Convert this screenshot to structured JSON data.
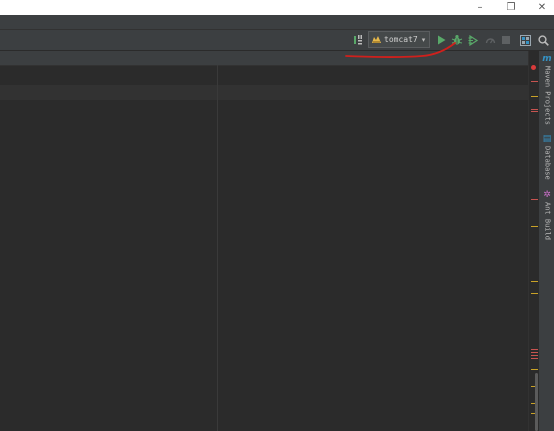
{
  "window": {
    "controls": {
      "minimize": "–",
      "restore": "❐",
      "close": "✕"
    }
  },
  "toolbar": {
    "run_config": {
      "label": "tomcat7",
      "icon": "tomcat-icon",
      "caret": "▾"
    },
    "icons": [
      "build-sync-icon",
      "run-icon",
      "debug-icon",
      "coverage-icon",
      "profile-icon",
      "stop-icon",
      "project-structure-icon",
      "search-icon"
    ]
  },
  "right_tool_strip": {
    "tabs": [
      {
        "label": "Maven Projects",
        "icon": "maven-icon",
        "glyph": "m"
      },
      {
        "label": "Database",
        "icon": "database-icon",
        "glyph": "▤"
      },
      {
        "label": "Ant Build",
        "icon": "ant-icon",
        "glyph": "✲"
      }
    ]
  },
  "colors": {
    "background": "#2b2b2b",
    "panel": "#3c3f41",
    "run_green": "#59a869",
    "annotation_red": "#d0201c",
    "marker_red": "#c75450",
    "marker_yellow": "#c9a227",
    "maven_blue": "#3592c4"
  }
}
